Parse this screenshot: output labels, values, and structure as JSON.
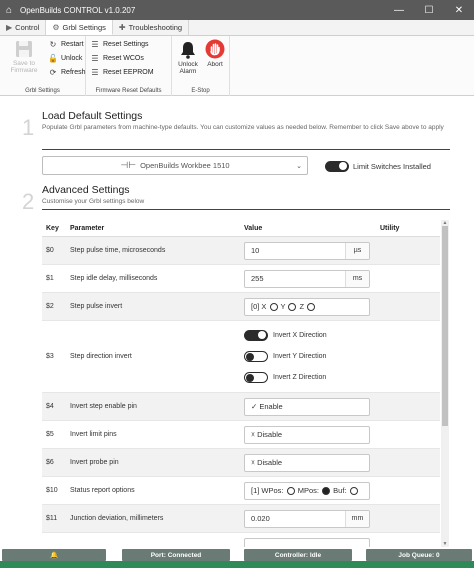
{
  "window": {
    "title": "OpenBuilds CONTROL v1.0.207",
    "minimize": "—",
    "maximize": "☐",
    "close": "✕"
  },
  "tabs": [
    {
      "label": "Control",
      "icon": "▶"
    },
    {
      "label": "Grbl Settings",
      "icon": "⚙"
    },
    {
      "label": "Troubleshooting",
      "icon": "✚"
    }
  ],
  "ribbon": {
    "grbl": {
      "label": "Grbl Settings",
      "save": "Save to Firmware",
      "restart": "Restart",
      "unlock": "Unlock",
      "refresh": "Refresh"
    },
    "reset": {
      "label": "Firmware Reset Defaults",
      "settings": "Reset Settings",
      "wcos": "Reset WCOs",
      "eeprom": "Reset EEPROM"
    },
    "estop": {
      "label": "E-Stop",
      "unlock_alarm": "Unlock Alarm",
      "abort": "Abort"
    }
  },
  "step1": {
    "number": "1",
    "title": "Load Default Settings",
    "desc": "Populate Grbl parameters from machine-type defaults. You can customize values as needed below. Remember to click Save above to apply",
    "machine": "OpenBuilds Workbee 1510",
    "limit_switches": "Limit Switches Installed"
  },
  "step2": {
    "number": "2",
    "title": "Advanced Settings",
    "desc": "Customise your Grbl settings below"
  },
  "table": {
    "headers": {
      "key": "Key",
      "parameter": "Parameter",
      "value": "Value",
      "utility": "Utility"
    },
    "rows": [
      {
        "key": "$0",
        "param": "Step pulse time, microseconds",
        "value": "10",
        "unit": "µs"
      },
      {
        "key": "$1",
        "param": "Step idle delay, milliseconds",
        "value": "255",
        "unit": "ms"
      },
      {
        "key": "$2",
        "param": "Step pulse invert",
        "value_prefix": "[0] X",
        "y": "Y",
        "z": "Z"
      },
      {
        "key": "$3",
        "param": "Step direction invert",
        "t1": "Invert X Direction",
        "t2": "Invert Y Direction",
        "t3": "Invert Z Direction"
      },
      {
        "key": "$4",
        "param": "Invert step enable pin",
        "value": "✓ Enable"
      },
      {
        "key": "$5",
        "param": "Invert limit pins",
        "value": "☓ Disable"
      },
      {
        "key": "$6",
        "param": "Invert probe pin",
        "value": "☓ Disable"
      },
      {
        "key": "$10",
        "param": "Status report options",
        "value_prefix": "[1] WPos:",
        "mpos": "MPos:",
        "buf": "Buf:"
      },
      {
        "key": "$11",
        "param": "Junction deviation, millimeters",
        "value": "0.020",
        "unit": "mm"
      }
    ]
  },
  "status": {
    "alarm_icon": "🔔",
    "port": "Port: Connected",
    "controller": "Controller: Idle",
    "queue": "Job Queue: 0"
  }
}
